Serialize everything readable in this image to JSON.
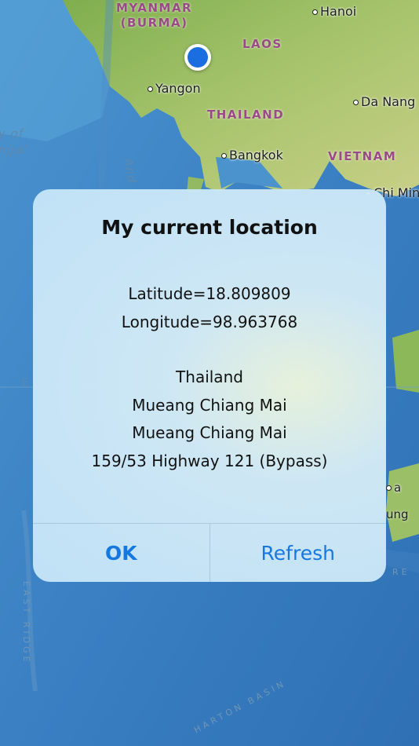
{
  "map": {
    "countries": {
      "myanmar": "MYANMAR",
      "burma": "(BURMA)",
      "laos": "LAOS",
      "thailand": "THAILAND",
      "vietnam": "VIETNAM"
    },
    "cities": {
      "hanoi": "Hanoi",
      "yangon": "Yangon",
      "da_nang": "Da Nang",
      "bangkok": "Bangkok",
      "ho_chi_minh": "Chi Minh"
    },
    "water": {
      "bay_of_bengal_1": "y of",
      "bay_of_bengal_2": "ngal",
      "andaman": "And",
      "east_ridge": "EAST RIDGE",
      "basin": "HARTON BASIN",
      "partial_a": "a",
      "partial_ung": "ung",
      "partial_re": "RE",
      "equator_mark": "E"
    },
    "colors": {
      "sea": "#3f86c6",
      "land": "#8cb85a",
      "location_dot": "#1a6ee0"
    }
  },
  "alert": {
    "title": "My current location",
    "latitude": "Latitude=18.809809",
    "longitude": "Longitude=98.963768",
    "country": "Thailand",
    "district": "Mueang Chiang Mai",
    "subdistrict": "Mueang Chiang Mai",
    "street": "159/53 Highway 121 (Bypass)",
    "ok_label": "OK",
    "refresh_label": "Refresh",
    "accent_color": "#1677e0"
  }
}
